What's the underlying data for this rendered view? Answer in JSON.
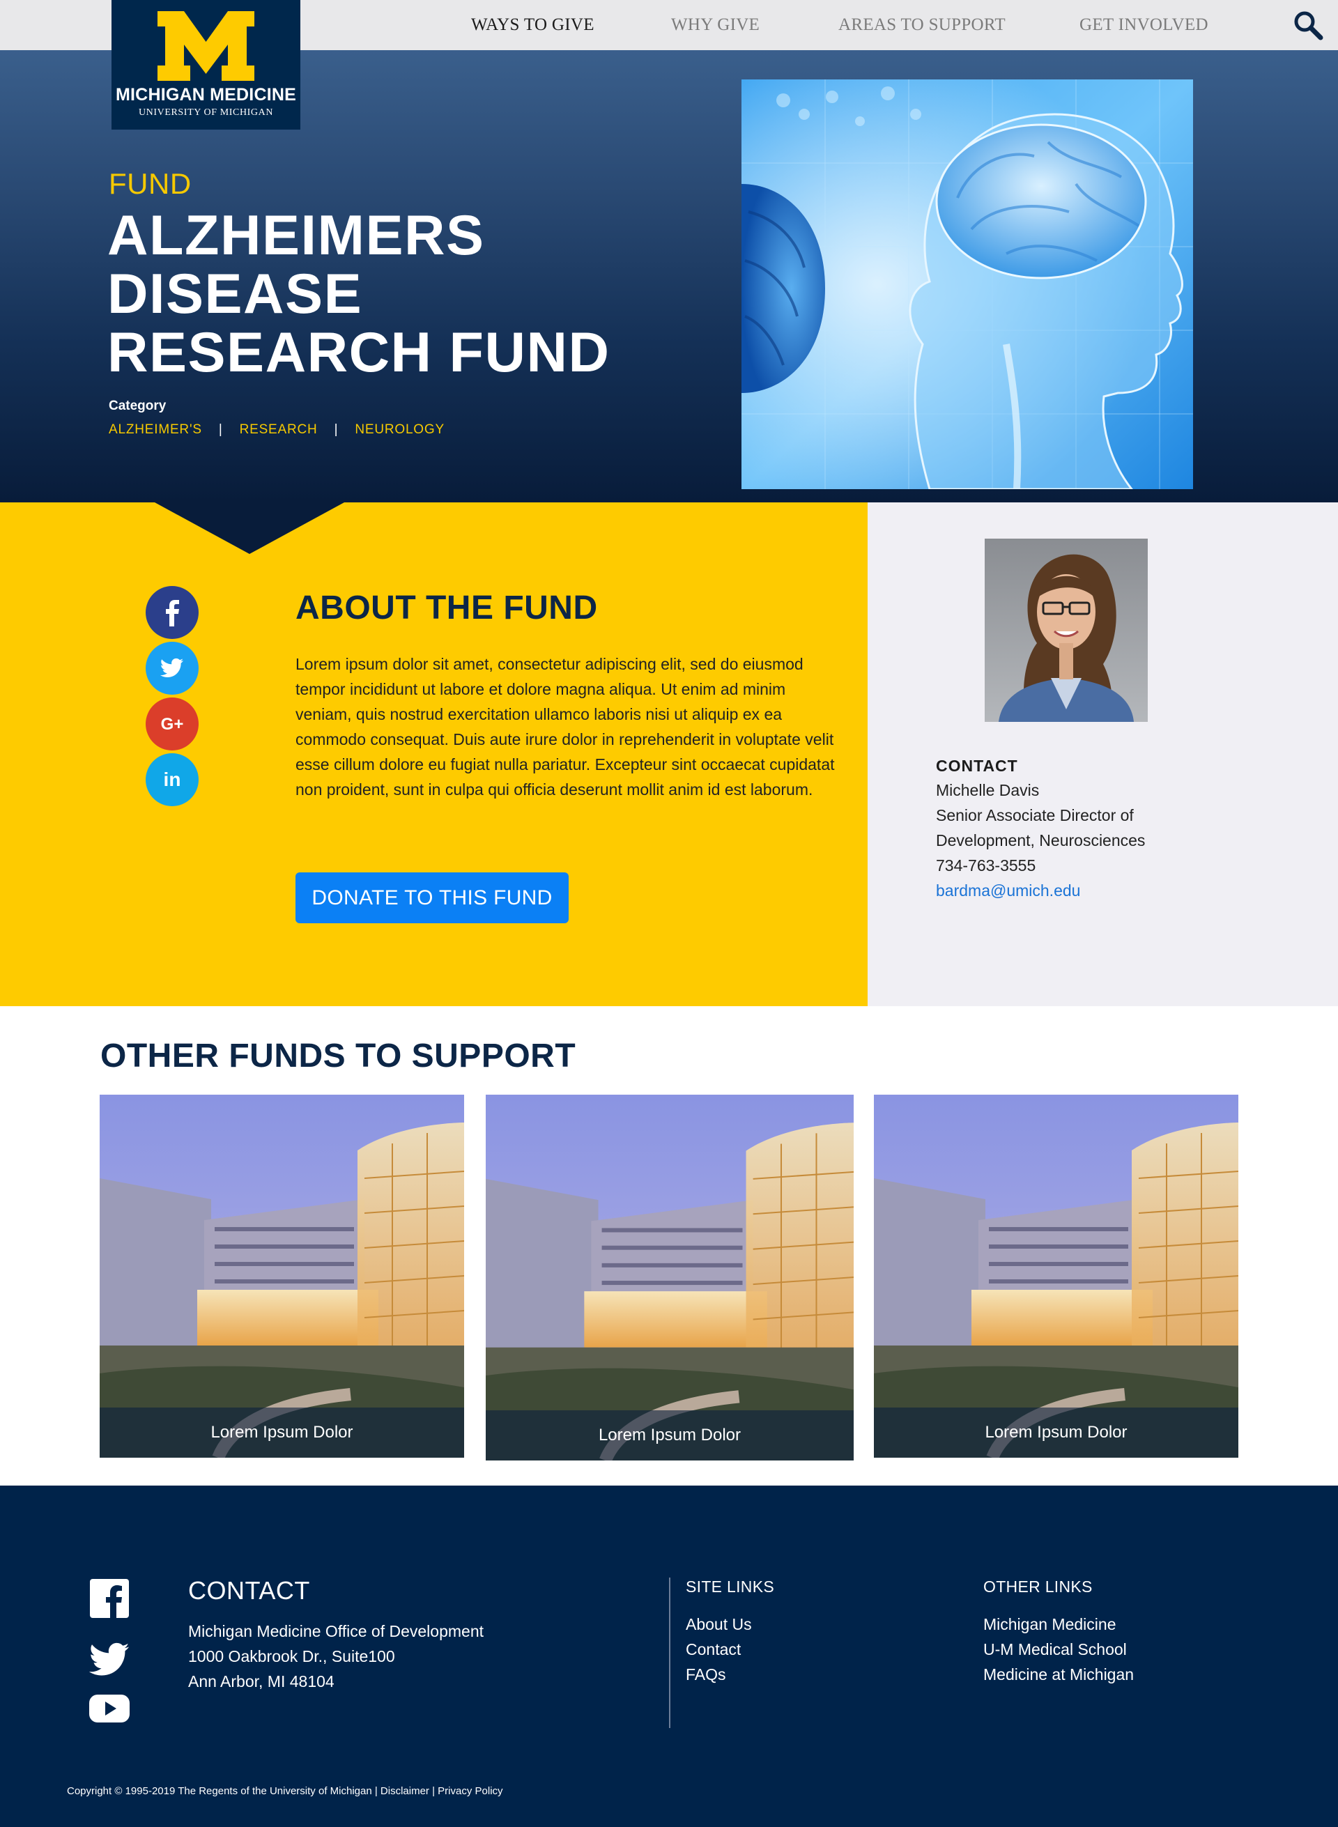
{
  "nav": {
    "items": [
      "WAYS TO GIVE",
      "WHY GIVE",
      "AREAS TO SUPPORT",
      "GET INVOLVED"
    ]
  },
  "logo": {
    "main": "MICHIGAN MEDICINE",
    "sub": "UNIVERSITY OF MICHIGAN"
  },
  "hero": {
    "kicker": "FUND",
    "title": "ALZHEIMERS DISEASE RESEARCH FUND",
    "category_label": "Category",
    "categories": [
      "ALZHEIMER'S",
      "RESEARCH",
      "NEUROLOGY"
    ]
  },
  "about": {
    "title": "ABOUT THE FUND",
    "body": "Lorem ipsum dolor sit amet, consectetur adipiscing elit, sed do eiusmod tempor incididunt ut labore et dolore magna aliqua. Ut enim ad minim veniam, quis nostrud exercitation ullamco laboris nisi ut aliquip ex ea commodo consequat. Duis aute irure dolor in reprehenderit in voluptate velit esse cillum dolore eu fugiat nulla pariatur. Excepteur sint occaecat cupidatat non proident, sunt in culpa qui officia deserunt mollit anim id est laborum.",
    "donate_label": "DONATE TO THIS FUND",
    "social_icons": [
      "facebook-icon",
      "twitter-icon",
      "google-plus-icon",
      "linkedin-icon"
    ]
  },
  "contact": {
    "label": "CONTACT",
    "name": "Michelle Davis",
    "title_line1": "Senior Associate Director of",
    "title_line2": "Development, Neurosciences",
    "phone": "734-763-3555",
    "email": "bardma@umich.edu"
  },
  "other_funds": {
    "title": "OTHER FUNDS TO SUPPORT",
    "cards": [
      {
        "caption": "Lorem Ipsum Dolor"
      },
      {
        "caption": "Lorem Ipsum Dolor"
      },
      {
        "caption": "Lorem Ipsum Dolor"
      }
    ]
  },
  "footer": {
    "contact_title": "CONTACT",
    "address": [
      "Michigan Medicine Office of Development",
      "1000 Oakbrook Dr., Suite100",
      "Ann Arbor, MI 48104"
    ],
    "site_links_title": "SITE LINKS",
    "site_links": [
      "About Us",
      "Contact",
      "FAQs"
    ],
    "other_links_title": "OTHER LINKS",
    "other_links": [
      "Michigan Medicine",
      "U-M Medical School",
      "Medicine at Michigan"
    ],
    "copyright": "Copyright © 1995-2019 The Regents of the University of Michigan",
    "disclaimer": "Disclaimer",
    "privacy": "Privacy Policy",
    "sep": " | "
  },
  "colors": {
    "maize": "#fecb00",
    "navy": "#00274c",
    "footer_navy": "#00234a",
    "donate_blue": "#0b80f5",
    "panel_gray": "#f0eff4"
  }
}
